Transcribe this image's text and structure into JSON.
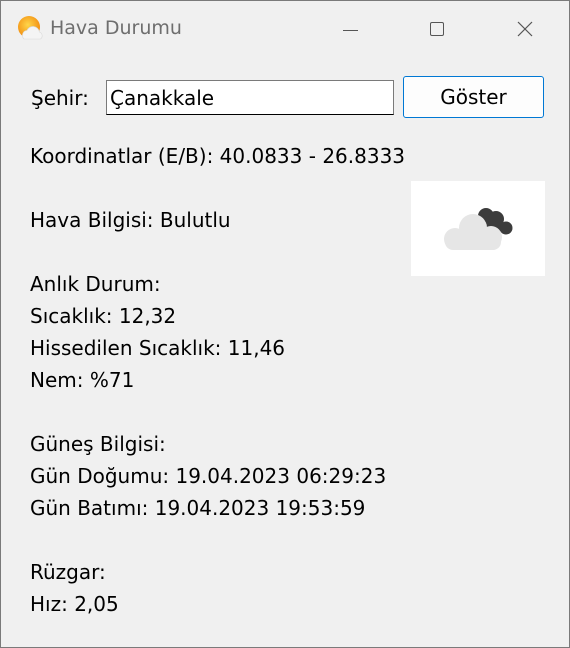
{
  "window": {
    "title": "Hava Durumu",
    "app_icon": "sun-cloud-icon"
  },
  "titlebar": {
    "minimize_icon": "minimize-icon",
    "maximize_icon": "maximize-icon",
    "close_icon": "close-icon"
  },
  "form": {
    "city_label": "Şehir:",
    "city_value": "Çanakkale",
    "show_button": "Göster"
  },
  "info": {
    "coordinates": "Koordinatlar (E/B): 40.0833 - 26.8333",
    "weather": "Hava Bilgisi: Bulutlu",
    "weather_icon": "cloudy-icon",
    "current_heading": "Anlık Durum:",
    "temperature": "Sıcaklık: 12,32",
    "feels_like": "Hissedilen Sıcaklık: 11,46",
    "humidity": "Nem: %71",
    "sun_heading": "Güneş Bilgisi:",
    "sunrise": "Gün Doğumu: 19.04.2023 06:29:23",
    "sunset": "Gün Batımı: 19.04.2023 19:53:59",
    "wind_heading": "Rüzgar:",
    "wind_speed": "Hız: 2,05"
  },
  "colors": {
    "window_bg": "#f0f0f0",
    "accent": "#0078d4",
    "cloud_light": "#e6e6e6",
    "cloud_dark": "#3c3c3c",
    "sun_orange": "#f7a21b"
  }
}
